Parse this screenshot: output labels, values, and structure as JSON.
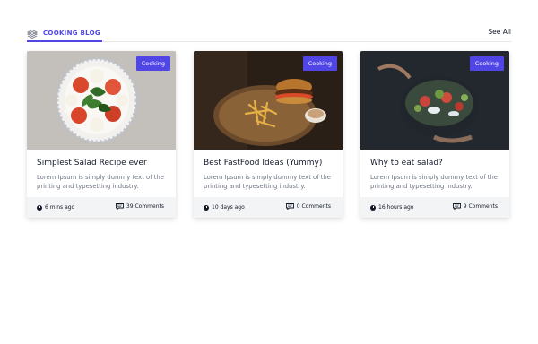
{
  "header": {
    "brand": "COOKING BLOG",
    "see_all": "See All"
  },
  "colors": {
    "accent": "#4f46e5"
  },
  "cards": [
    {
      "badge": "Cooking",
      "title": "Simplest Salad Recipe ever",
      "description": "Lorem Ipsum is simply dummy text of the printing and typesetting industry.",
      "time": "6 mins ago",
      "comments": "39 Comments"
    },
    {
      "badge": "Cooking",
      "title": "Best FastFood Ideas (Yummy)",
      "description": "Lorem Ipsum is simply dummy text of the printing and typesetting industry.",
      "time": "10 days ago",
      "comments": "0 Comments"
    },
    {
      "badge": "Cooking",
      "title": "Why to eat salad?",
      "description": "Lorem Ipsum is simply dummy text of the printing and typesetting industry.",
      "time": "16 hours ago",
      "comments": "9 Comments"
    }
  ]
}
